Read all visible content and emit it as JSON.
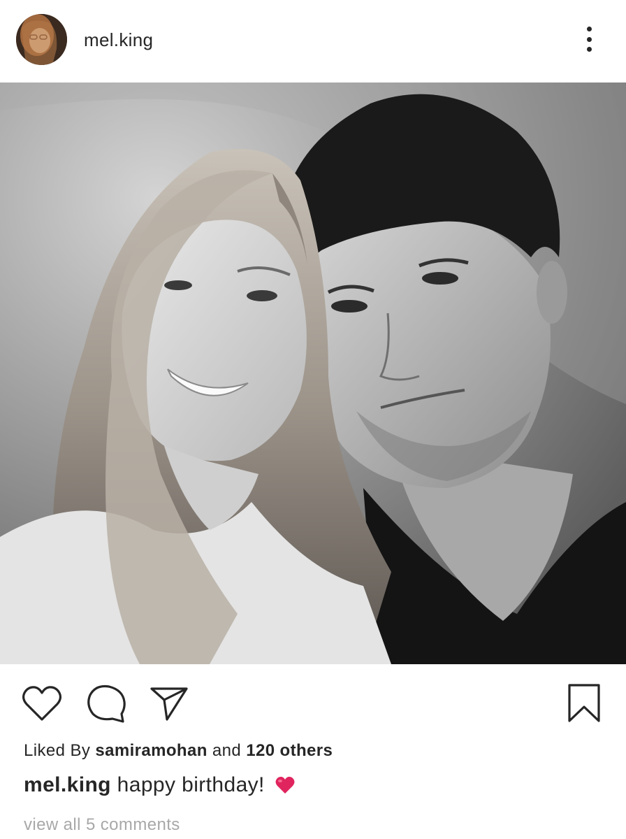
{
  "post": {
    "author": "mel.king",
    "menu_icon": "more-vertical-icon",
    "photo_icon": "photo-image",
    "actions": {
      "like_icon": "heart-outline-icon",
      "comment_icon": "comment-bubble-icon",
      "share_icon": "paper-plane-icon",
      "save_icon": "bookmark-outline-icon"
    },
    "likes": {
      "prefix": "Liked By",
      "liker": "samiramohan",
      "joiner": "and",
      "others": "120 others"
    },
    "caption": {
      "author": "mel.king",
      "text": "happy birthday!",
      "emoji_icon": "red-heart-emoji",
      "emoji_color": "#e0245e"
    },
    "view_comments": "view all 5 comments"
  },
  "colors": {
    "text": "#262626",
    "muted": "#a8a8a8",
    "background": "#ffffff"
  }
}
